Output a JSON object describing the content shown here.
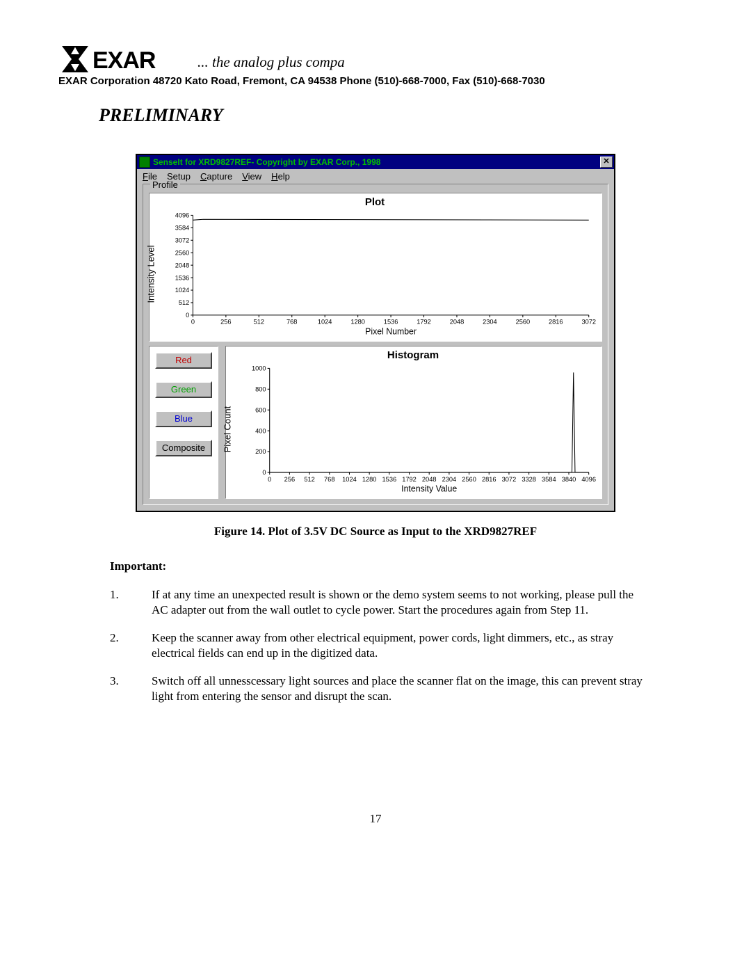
{
  "header": {
    "tagline": "... the analog plus compa",
    "company_line": "EXAR Corporation  48720 Kato Road, Fremont, CA 94538 Phone (510)-668-7000, Fax (510)-668-7030",
    "preliminary": "PRELIMINARY"
  },
  "window": {
    "title": "SenseIt for XRD9827REF- Copyright by EXAR Corp., 1998",
    "menu": {
      "file": "File",
      "setup": "Setup",
      "capture": "Capture",
      "view": "View",
      "help": "Help"
    },
    "profile_legend": "Profile",
    "plot_title": "Plot",
    "plot_ylabel": "Intensity Level",
    "plot_xlabel": "Pixel Number",
    "hist_title": "Histogram",
    "hist_ylabel": "Pixel Count",
    "hist_xlabel": "Intensity Value",
    "channels": {
      "red": "Red",
      "green": "Green",
      "blue": "Blue",
      "composite": "Composite"
    }
  },
  "chart_data": [
    {
      "type": "line",
      "name": "plot",
      "title": "Plot",
      "xlabel": "Pixel Number",
      "ylabel": "Intensity Level",
      "xlim": [
        0,
        3072
      ],
      "ylim": [
        0,
        4096
      ],
      "xticks": [
        0,
        256,
        512,
        768,
        1024,
        1280,
        1536,
        1792,
        2048,
        2304,
        2560,
        2816,
        3072
      ],
      "yticks": [
        0,
        512,
        1024,
        1536,
        2048,
        2560,
        3072,
        3584,
        4096
      ],
      "series": [
        {
          "name": "trace",
          "points": [
            [
              0,
              3900
            ],
            [
              80,
              3930
            ],
            [
              3072,
              3900
            ]
          ]
        }
      ]
    },
    {
      "type": "line",
      "name": "histogram",
      "title": "Histogram",
      "xlabel": "Intensity Value",
      "ylabel": "Pixel Count",
      "xlim": [
        0,
        4096
      ],
      "ylim": [
        0,
        1000
      ],
      "xticks": [
        0,
        256,
        512,
        768,
        1024,
        1280,
        1536,
        1792,
        2048,
        2304,
        2560,
        2816,
        3072,
        3328,
        3584,
        3840,
        4096
      ],
      "yticks": [
        0,
        200,
        400,
        600,
        800,
        1000
      ],
      "series": [
        {
          "name": "spike",
          "points": [
            [
              0,
              0
            ],
            [
              3880,
              0
            ],
            [
              3900,
              960
            ],
            [
              3920,
              0
            ],
            [
              4096,
              0
            ]
          ]
        }
      ]
    }
  ],
  "caption": "Figure 14. Plot of 3.5V DC Source as Input to the XRD9827REF",
  "important_hdr": "Important:",
  "notes": [
    {
      "n": "1.",
      "t": "If at any time an unexpected result is shown or the demo system seems to not working, please pull the AC adapter out from the wall outlet to cycle power. Start the procedures again from Step 11."
    },
    {
      "n": "2.",
      "t": "Keep the scanner away from other electrical equipment, power cords, light dimmers, etc., as stray electrical fields can end up in the digitized data."
    },
    {
      "n": "3.",
      "t": "Switch off all unnesscessary light sources and place the scanner flat on the image, this can prevent stray light from entering the sensor and disrupt the scan."
    }
  ],
  "page_number": "17"
}
